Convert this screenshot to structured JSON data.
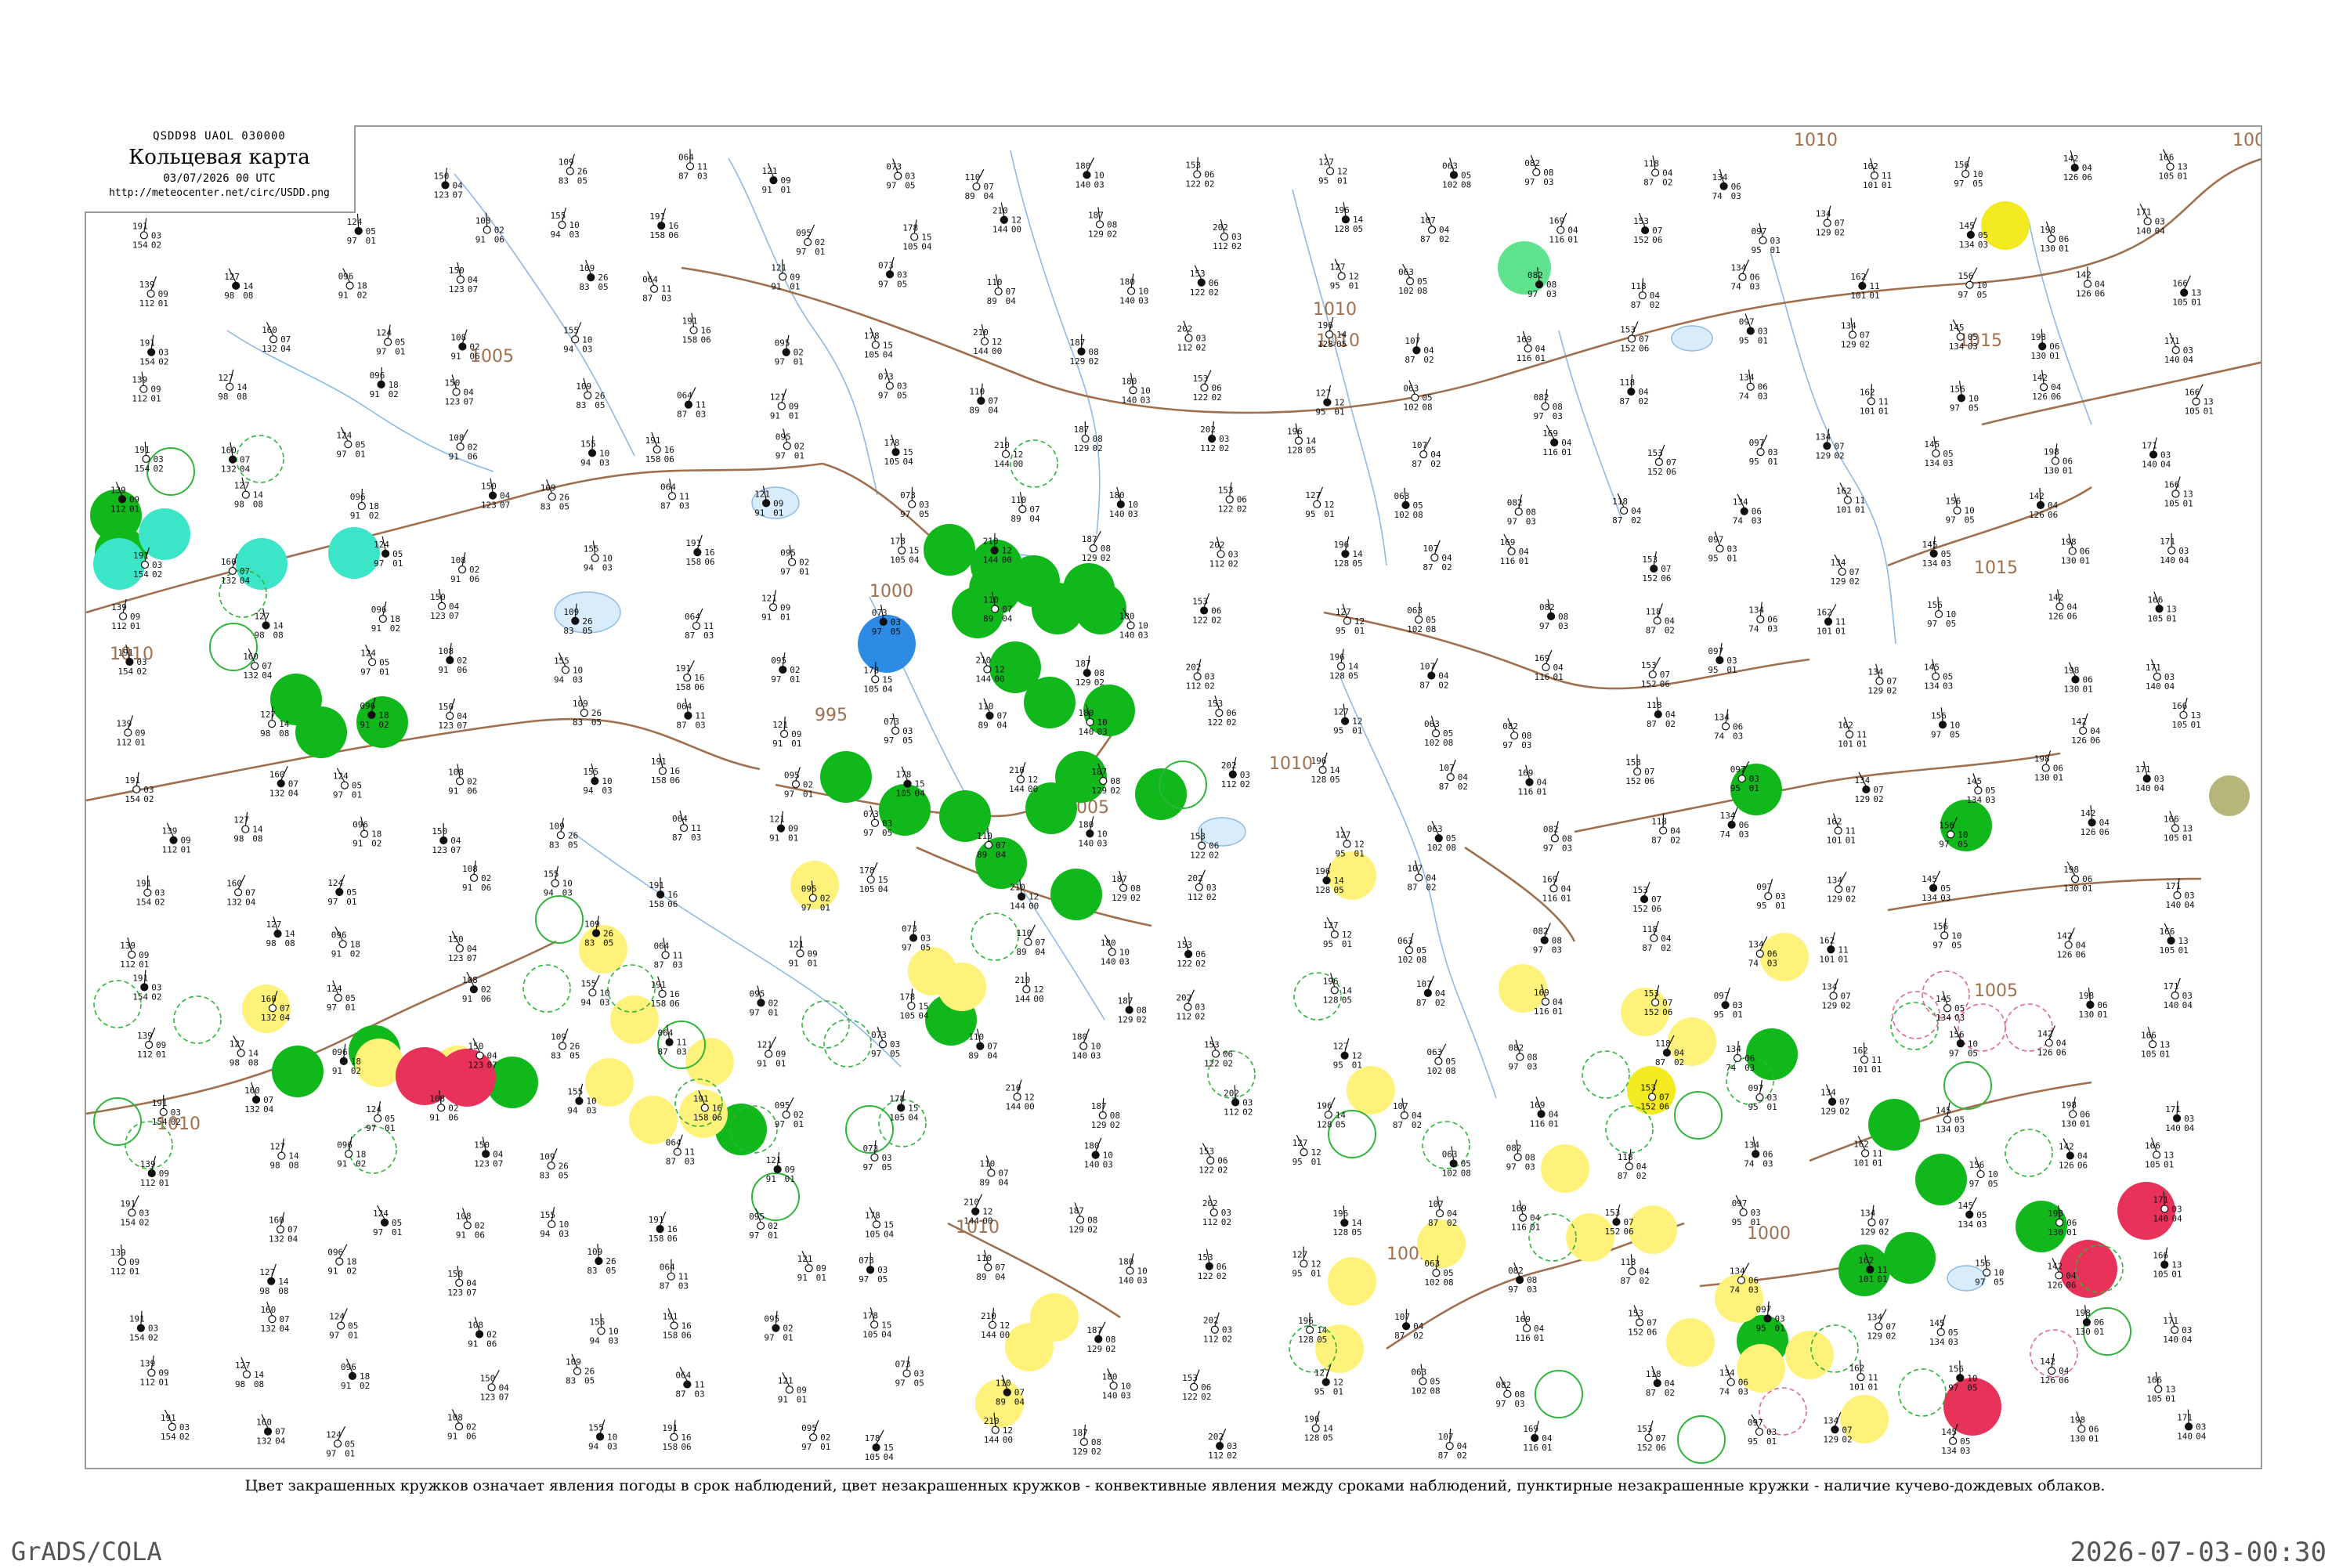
{
  "header": {
    "code": "QSDD98  UAOL  030000",
    "title": "Кольцевая карта",
    "date": "03/07/2026 00 UTC",
    "url": "http://meteocenter.net/circ/USDD.png"
  },
  "caption": "Цвет закрашенных кружков означает явления погоды в срок наблюдений, цвет незакрашенных кружков - конвективные явления между сроками наблюдений, пунктирные незакрашенные кружки - наличие кучево-дождевых облаков.",
  "footer": {
    "left": "GrADS/COLA",
    "right": "2026-07-03-00:30"
  },
  "colors": {
    "isobar": "#a0704e",
    "river": "#8db9e6",
    "thunder": "#11b81c",
    "showers": "#fff27a",
    "severe": "#e8325a",
    "cyan": "#3be6c8",
    "mint": "#5fe28e",
    "blue": "#2d8be6",
    "olive": "#b7b57a",
    "gold": "#f4ea20",
    "ring_green": "#2fb53a",
    "ring_red": "#e06a8a"
  },
  "isobar_labels": [
    "1010",
    "1010",
    "1005",
    "1000",
    "995",
    "1005",
    "1010",
    "1010",
    "1015",
    "1015",
    "1005",
    "1005",
    "1010",
    "1010",
    "1005",
    "1000",
    "1010"
  ],
  "stations": [
    {
      "a": "139",
      "b": "09",
      "c": "112",
      "d": "01"
    },
    {
      "a": "127",
      "b": "14",
      "c": "98",
      "d": "08"
    },
    {
      "a": "096",
      "b": "18",
      "c": "91",
      "d": "02"
    },
    {
      "a": "150",
      "b": "04",
      "c": "123",
      "d": "07"
    },
    {
      "a": "109",
      "b": "26",
      "c": "83",
      "d": "05"
    },
    {
      "a": "064",
      "b": "11",
      "c": "87",
      "d": "03"
    },
    {
      "a": "121",
      "b": "09",
      "c": "91",
      "d": "01"
    },
    {
      "a": "073",
      "b": "03",
      "c": "97",
      "d": "05"
    },
    {
      "a": "110",
      "b": "07",
      "c": "89",
      "d": "04"
    },
    {
      "a": "180",
      "b": "10",
      "c": "140",
      "d": "03"
    },
    {
      "a": "153",
      "b": "06",
      "c": "122",
      "d": "02"
    },
    {
      "a": "127",
      "b": "12",
      "c": "95",
      "d": "01"
    },
    {
      "a": "063",
      "b": "05",
      "c": "102",
      "d": "08"
    },
    {
      "a": "082",
      "b": "08",
      "c": "97",
      "d": "03"
    },
    {
      "a": "118",
      "b": "04",
      "c": "87",
      "d": "02"
    },
    {
      "a": "134",
      "b": "06",
      "c": "74",
      "d": "03"
    },
    {
      "a": "162",
      "b": "11",
      "c": "101",
      "d": "01"
    },
    {
      "a": "156",
      "b": "10",
      "c": "97",
      "d": "05"
    },
    {
      "a": "142",
      "b": "04",
      "c": "126",
      "d": "06"
    },
    {
      "a": "166",
      "b": "13",
      "c": "105",
      "d": "01"
    },
    {
      "a": "191",
      "b": "03",
      "c": "154",
      "d": "02"
    },
    {
      "a": "160",
      "b": "07",
      "c": "132",
      "d": "04"
    },
    {
      "a": "124",
      "b": "05",
      "c": "97",
      "d": "01"
    },
    {
      "a": "108",
      "b": "02",
      "c": "91",
      "d": "06"
    },
    {
      "a": "155",
      "b": "10",
      "c": "94",
      "d": "03"
    },
    {
      "a": "191",
      "b": "16",
      "c": "158",
      "d": "06"
    },
    {
      "a": "095",
      "b": "02",
      "c": "97",
      "d": "01"
    },
    {
      "a": "178",
      "b": "15",
      "c": "105",
      "d": "04"
    },
    {
      "a": "210",
      "b": "12",
      "c": "144",
      "d": "00"
    },
    {
      "a": "187",
      "b": "08",
      "c": "129",
      "d": "02"
    },
    {
      "a": "202",
      "b": "03",
      "c": "112",
      "d": "02"
    },
    {
      "a": "196",
      "b": "14",
      "c": "128",
      "d": "05"
    },
    {
      "a": "107",
      "b": "04",
      "c": "87",
      "d": "02"
    },
    {
      "a": "169",
      "b": "04",
      "c": "116",
      "d": "01"
    },
    {
      "a": "153",
      "b": "07",
      "c": "152",
      "d": "06"
    },
    {
      "a": "097",
      "b": "03",
      "c": "95",
      "d": "01"
    },
    {
      "a": "134",
      "b": "07",
      "c": "129",
      "d": "02"
    },
    {
      "a": "145",
      "b": "05",
      "c": "134",
      "d": "03"
    },
    {
      "a": "198",
      "b": "06",
      "c": "130",
      "d": "01"
    },
    {
      "a": "171",
      "b": "03",
      "c": "140",
      "d": "04"
    }
  ],
  "weather_circles": [
    {
      "kind": "filled",
      "color": "thunder",
      "count": 34
    },
    {
      "kind": "filled",
      "color": "showers",
      "count": 30
    },
    {
      "kind": "filled",
      "color": "severe",
      "count": 6
    },
    {
      "kind": "filled",
      "color": "cyan",
      "count": 4
    },
    {
      "kind": "filled",
      "color": "mint",
      "count": 1
    },
    {
      "kind": "filled",
      "color": "blue",
      "count": 1
    },
    {
      "kind": "filled",
      "color": "olive",
      "count": 1
    },
    {
      "kind": "filled",
      "color": "gold",
      "count": 2
    },
    {
      "kind": "ring",
      "color": "ring_green",
      "count": 40
    },
    {
      "kind": "ring",
      "color": "ring_red",
      "count": 6
    }
  ]
}
